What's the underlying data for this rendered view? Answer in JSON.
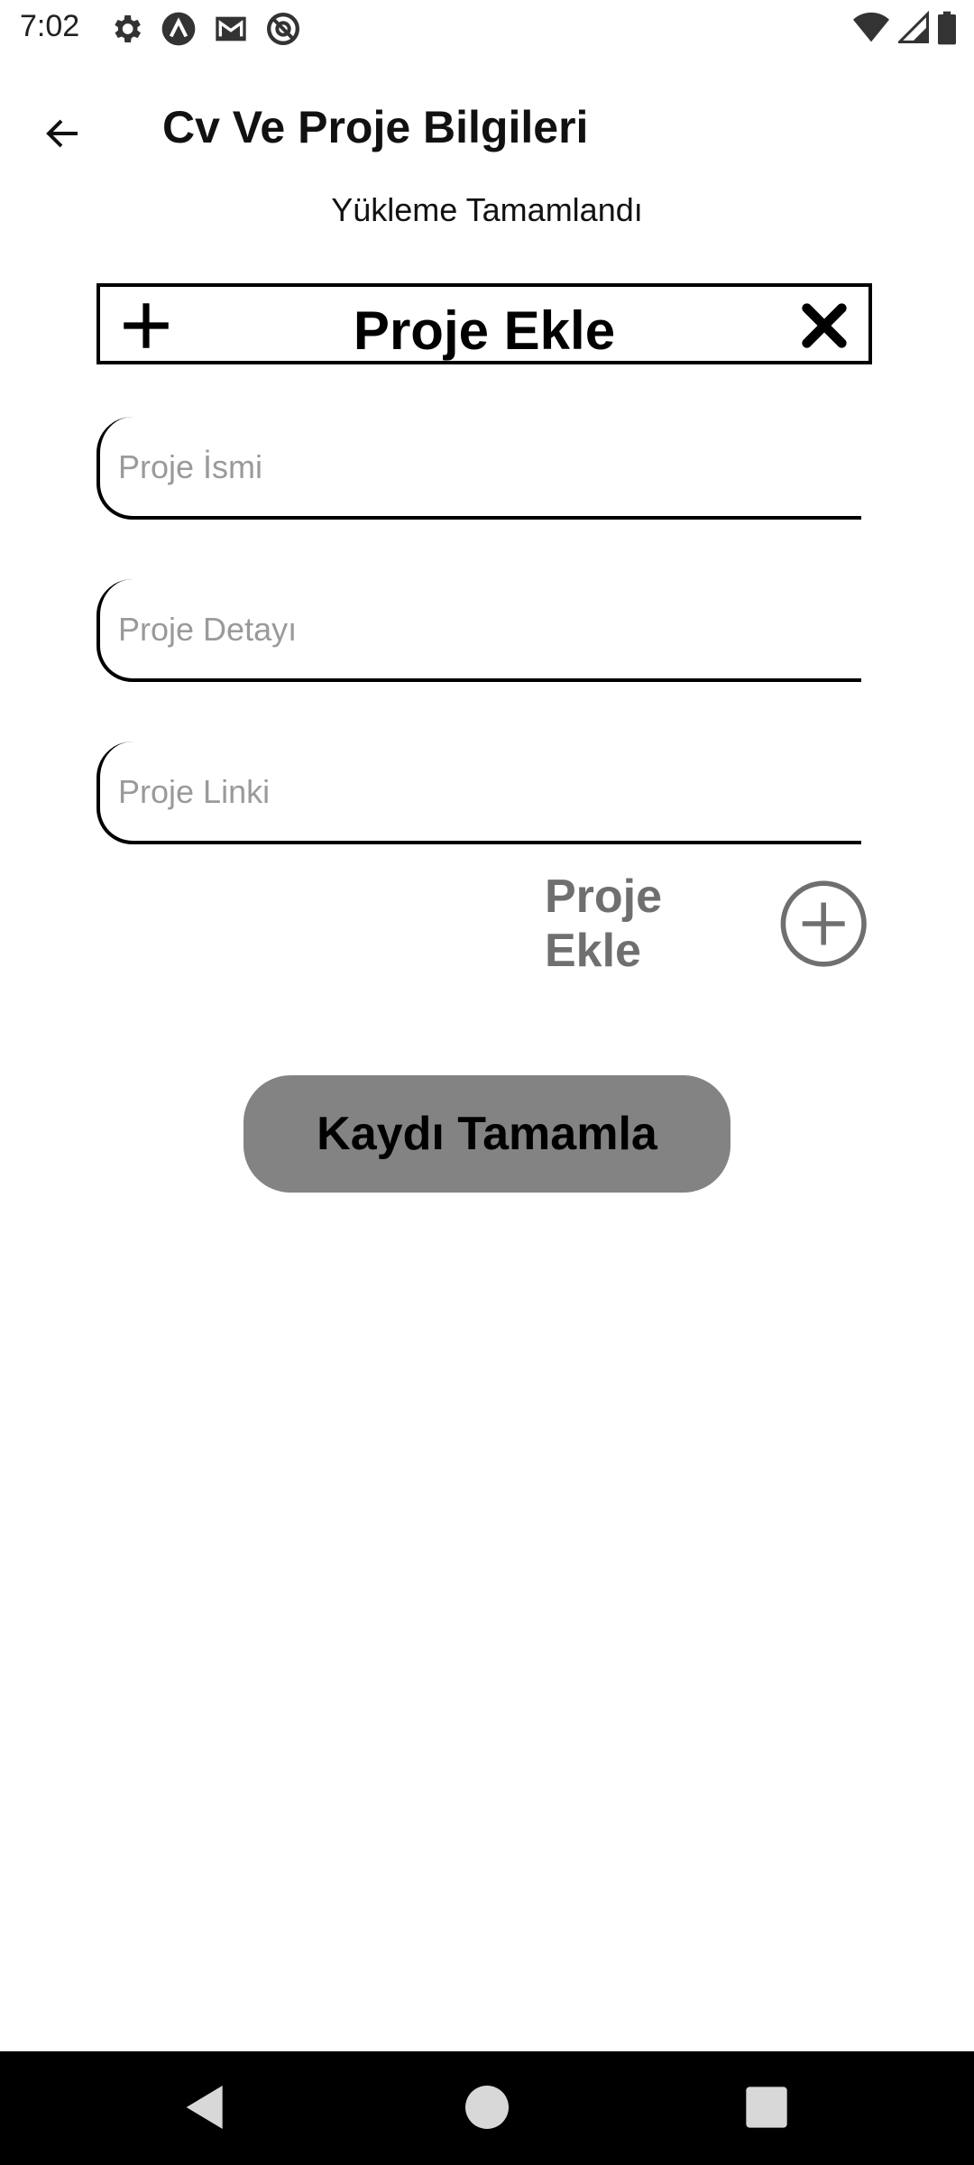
{
  "status_bar": {
    "time": "7:02",
    "left_icons": [
      "settings-icon",
      "app-icon",
      "gmail-icon",
      "do-not-disturb-icon"
    ],
    "right_icons": [
      "wifi-icon",
      "signal-icon",
      "battery-icon"
    ]
  },
  "app_bar": {
    "title": "Cv Ve Proje Bilgileri",
    "back_icon": "arrow-left-icon"
  },
  "upload_status": "Yükleme Tamamlandı",
  "project_header": {
    "title": "Proje Ekle",
    "left_icon": "plus-icon",
    "right_icon": "close-icon"
  },
  "form": {
    "project_name_placeholder": "Proje İsmi",
    "project_detail_placeholder": "Proje Detayı",
    "project_link_placeholder": "Proje Linki",
    "project_name_value": "",
    "project_detail_value": "",
    "project_link_value": ""
  },
  "add_project": {
    "label": "Proje Ekle",
    "icon": "add-circle-icon"
  },
  "submit": {
    "label": "Kaydı Tamamla"
  },
  "colors": {
    "submit_background": "#838383",
    "add_project_text": "#6f6f6f",
    "placeholder": "#9a9a9a"
  },
  "nav_bar": {
    "icons": [
      "nav-back-icon",
      "nav-home-icon",
      "nav-recents-icon"
    ]
  }
}
